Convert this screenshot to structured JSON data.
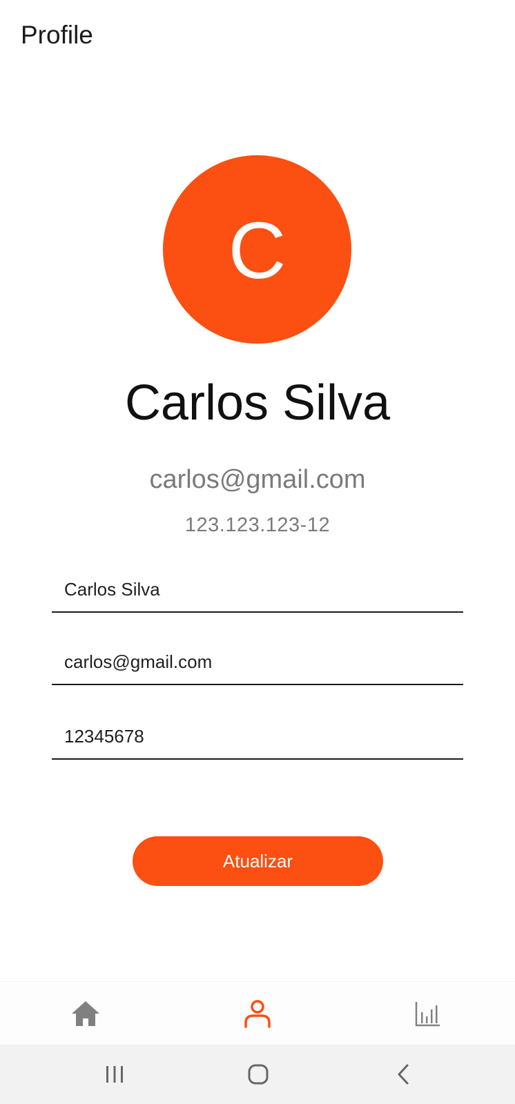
{
  "header": {
    "title": "Profile"
  },
  "profile": {
    "avatar_initial": "C",
    "avatar_color": "#FC4F12",
    "name": "Carlos Silva",
    "email": "carlos@gmail.com",
    "document": "123.123.123-12"
  },
  "form": {
    "name_value": "Carlos Silva",
    "email_value": "carlos@gmail.com",
    "password_value": "12345678",
    "submit_label": "Atualizar"
  },
  "bottom_nav": {
    "items": [
      {
        "icon": "home-icon",
        "active": false
      },
      {
        "icon": "user-icon",
        "active": true
      },
      {
        "icon": "bar-chart-icon",
        "active": false
      }
    ],
    "active_color": "#FC4F12",
    "inactive_color": "#808080"
  },
  "system_nav": {
    "buttons": [
      "recent-apps-icon",
      "home-circle-icon",
      "back-icon"
    ]
  }
}
